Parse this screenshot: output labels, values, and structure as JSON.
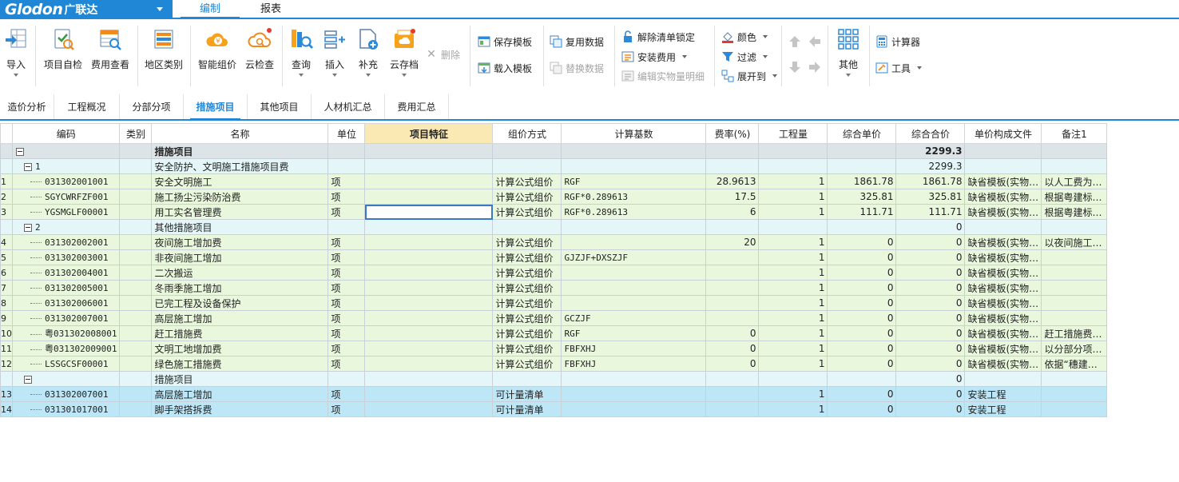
{
  "app": {
    "brand": "Glodon",
    "brand_cn": "广联达"
  },
  "menu": [
    {
      "label": "编制",
      "active": true
    },
    {
      "label": "报表",
      "active": false
    }
  ],
  "ribbon": {
    "import": "导入",
    "self_check": "项目自检",
    "fee_view": "费用查看",
    "region": "地区类别",
    "smart_price": "智能组价",
    "cloud_check": "云检查",
    "query": "查询",
    "insert": "插入",
    "supplement": "补充",
    "cloud_archive": "云存档",
    "delete": "删除",
    "save_template": "保存模板",
    "load_template": "载入模板",
    "reuse_data": "复用数据",
    "replace_data": "替换数据",
    "unlock_list": "解除清单锁定",
    "install_fee": "安装费用",
    "edit_detail": "编辑实物量明细",
    "color": "颜色",
    "filter": "过滤",
    "expand_to": "展开到",
    "other": "其他",
    "calculator": "计算器",
    "tools": "工具"
  },
  "subtabs": [
    "造价分析",
    "工程概况",
    "分部分项",
    "措施项目",
    "其他项目",
    "人材机汇总",
    "费用汇总"
  ],
  "active_subtab": 3,
  "table": {
    "headers": [
      "编码",
      "类别",
      "名称",
      "单位",
      "项目特征",
      "组价方式",
      "计算基数",
      "费率(%)",
      "工程量",
      "综合单价",
      "综合合价",
      "单价构成文件",
      "备注1"
    ],
    "rows": [
      {
        "rn": "",
        "type": "head",
        "level": 0,
        "code": "",
        "cat": "",
        "name": "措施项目",
        "unit": "",
        "feat": "",
        "method": "",
        "base": "",
        "rate": "",
        "qty": "",
        "price": "",
        "total": "2299.3",
        "file": "",
        "note": ""
      },
      {
        "rn": "",
        "type": "group",
        "level": 1,
        "code": "1",
        "cat": "",
        "name": "安全防护、文明施工措施项目费",
        "unit": "",
        "feat": "",
        "method": "",
        "base": "",
        "rate": "",
        "qty": "",
        "price": "",
        "total": "2299.3",
        "file": "",
        "note": ""
      },
      {
        "rn": "1",
        "type": "item",
        "level": 2,
        "code": "031302001001",
        "cat": "",
        "name": "安全文明施工",
        "unit": "项",
        "feat": "",
        "method": "计算公式组价",
        "base": "RGF",
        "rate": "28.9613",
        "qty": "1",
        "price": "1861.78",
        "total": "1861.78",
        "file": "缺省模板(实物…",
        "note": "以人工费为…"
      },
      {
        "rn": "2",
        "type": "item",
        "level": 2,
        "code": "SGYCWRFZF001",
        "cat": "",
        "name": "施工扬尘污染防治费",
        "unit": "项",
        "feat": "",
        "method": "计算公式组价",
        "base": "RGF*0.289613",
        "rate": "17.5",
        "qty": "1",
        "price": "325.81",
        "total": "325.81",
        "file": "缺省模板(实物…",
        "note": "根据粤建标…"
      },
      {
        "rn": "3",
        "type": "item",
        "level": 2,
        "code": "YGSMGLF00001",
        "cat": "",
        "name": "用工实名管理费",
        "unit": "项",
        "feat": "",
        "method": "计算公式组价",
        "base": "RGF*0.289613",
        "rate": "6",
        "qty": "1",
        "price": "111.71",
        "total": "111.71",
        "file": "缺省模板(实物…",
        "note": "根据粤建标…",
        "selected": true
      },
      {
        "rn": "",
        "type": "group",
        "level": 1,
        "code": "2",
        "cat": "",
        "name": "其他措施项目",
        "unit": "",
        "feat": "",
        "method": "",
        "base": "",
        "rate": "",
        "qty": "",
        "price": "",
        "total": "0",
        "file": "",
        "note": ""
      },
      {
        "rn": "4",
        "type": "item",
        "level": 2,
        "code": "031302002001",
        "cat": "",
        "name": "夜间施工增加费",
        "unit": "项",
        "feat": "",
        "method": "计算公式组价",
        "base": "",
        "rate": "20",
        "qty": "1",
        "price": "0",
        "total": "0",
        "file": "缺省模板(实物…",
        "note": "以夜间施工…"
      },
      {
        "rn": "5",
        "type": "item",
        "level": 2,
        "code": "031302003001",
        "cat": "",
        "name": "非夜间施工增加",
        "unit": "项",
        "feat": "",
        "method": "计算公式组价",
        "base": "GJZJF+DXSZJF",
        "rate": "",
        "qty": "1",
        "price": "0",
        "total": "0",
        "file": "缺省模板(实物…",
        "note": ""
      },
      {
        "rn": "6",
        "type": "item",
        "level": 2,
        "code": "031302004001",
        "cat": "",
        "name": "二次搬运",
        "unit": "项",
        "feat": "",
        "method": "计算公式组价",
        "base": "",
        "rate": "",
        "qty": "1",
        "price": "0",
        "total": "0",
        "file": "缺省模板(实物…",
        "note": ""
      },
      {
        "rn": "7",
        "type": "item",
        "level": 2,
        "code": "031302005001",
        "cat": "",
        "name": "冬雨季施工增加",
        "unit": "项",
        "feat": "",
        "method": "计算公式组价",
        "base": "",
        "rate": "",
        "qty": "1",
        "price": "0",
        "total": "0",
        "file": "缺省模板(实物…",
        "note": ""
      },
      {
        "rn": "8",
        "type": "item",
        "level": 2,
        "code": "031302006001",
        "cat": "",
        "name": "已完工程及设备保护",
        "unit": "项",
        "feat": "",
        "method": "计算公式组价",
        "base": "",
        "rate": "",
        "qty": "1",
        "price": "0",
        "total": "0",
        "file": "缺省模板(实物…",
        "note": ""
      },
      {
        "rn": "9",
        "type": "item",
        "level": 2,
        "code": "031302007001",
        "cat": "",
        "name": "高层施工增加",
        "unit": "项",
        "feat": "",
        "method": "计算公式组价",
        "base": "GCZJF",
        "rate": "",
        "qty": "1",
        "price": "0",
        "total": "0",
        "file": "缺省模板(实物…",
        "note": ""
      },
      {
        "rn": "10",
        "type": "item",
        "level": 2,
        "code": "粤031302008001",
        "cat": "",
        "name": "赶工措施费",
        "unit": "项",
        "feat": "",
        "method": "计算公式组价",
        "base": "RGF",
        "rate": "0",
        "qty": "1",
        "price": "0",
        "total": "0",
        "file": "缺省模板(实物…",
        "note": "赶工措施费…"
      },
      {
        "rn": "11",
        "type": "item",
        "level": 2,
        "code": "粤031302009001",
        "cat": "",
        "name": "文明工地增加费",
        "unit": "项",
        "feat": "",
        "method": "计算公式组价",
        "base": "FBFXHJ",
        "rate": "0",
        "qty": "1",
        "price": "0",
        "total": "0",
        "file": "缺省模板(实物…",
        "note": "以分部分项…"
      },
      {
        "rn": "12",
        "type": "item",
        "level": 2,
        "code": "LSSGCSF00001",
        "cat": "",
        "name": "绿色施工措施费",
        "unit": "项",
        "feat": "",
        "method": "计算公式组价",
        "base": "FBFXHJ",
        "rate": "0",
        "qty": "1",
        "price": "0",
        "total": "0",
        "file": "缺省模板(实物…",
        "note": "依据“穗建…"
      },
      {
        "rn": "",
        "type": "group",
        "level": 1,
        "code": "",
        "cat": "",
        "name": "措施项目",
        "unit": "",
        "feat": "",
        "method": "",
        "base": "",
        "rate": "",
        "qty": "",
        "price": "",
        "total": "0",
        "file": "",
        "note": ""
      },
      {
        "rn": "13",
        "type": "blue",
        "level": 2,
        "code": "031302007001",
        "cat": "",
        "name": "高层施工增加",
        "unit": "项",
        "feat": "",
        "method": "可计量清单",
        "base": "",
        "rate": "",
        "qty": "1",
        "price": "0",
        "total": "0",
        "file": "安装工程",
        "note": ""
      },
      {
        "rn": "14",
        "type": "blue",
        "level": 2,
        "code": "031301017001",
        "cat": "",
        "name": "脚手架搭拆费",
        "unit": "项",
        "feat": "",
        "method": "可计量清单",
        "base": "",
        "rate": "",
        "qty": "1",
        "price": "0",
        "total": "0",
        "file": "安装工程",
        "note": ""
      }
    ]
  }
}
